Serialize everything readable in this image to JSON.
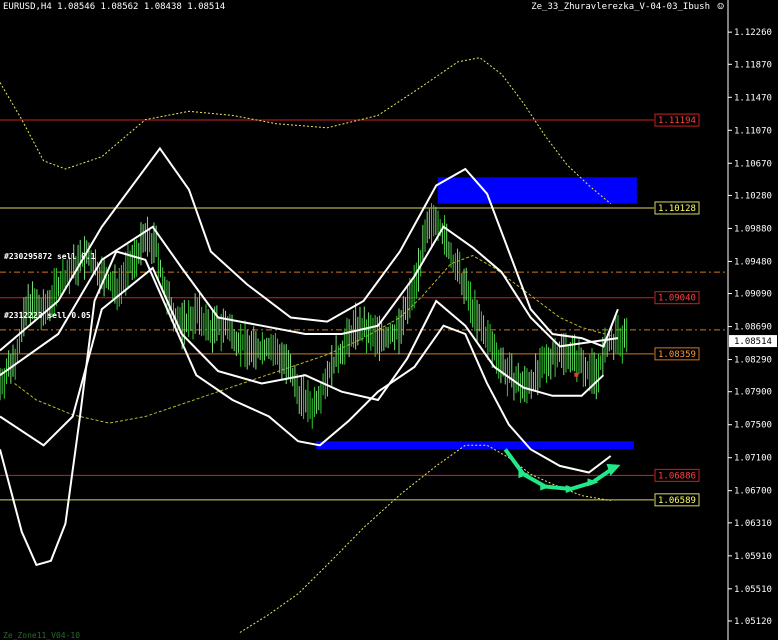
{
  "header": {
    "symbol_ohlc": "EURUSD,H4  1.08546 1.08562 1.08438 1.08514",
    "indicator_name": "Ze_33_Zhuravlerezka_V-04-03_Ibush",
    "smile": "☺"
  },
  "orders": [
    {
      "text": "#230295872 sell 0.1"
    },
    {
      "text": "#2312223 sell 0.05"
    }
  ],
  "footer": "Ze_Zone11_V04-10",
  "chart_data": {
    "type": "candlestick",
    "ylim": [
      1.0495,
      1.1248
    ],
    "yticks": [
      "1.12260",
      "1.11870",
      "1.11470",
      "1.11070",
      "1.10670",
      "1.10280",
      "1.09880",
      "1.09480",
      "1.09090",
      "1.08690",
      "1.08290",
      "1.07900",
      "1.07500",
      "1.07100",
      "1.06700",
      "1.06310",
      "1.05910",
      "1.05510",
      "1.05120"
    ],
    "current_price": "1.08514",
    "levels": [
      {
        "label": "1.11194",
        "value": 1.11194,
        "color": "#cc2222",
        "text": "#ff4040",
        "style": "solid"
      },
      {
        "label": "1.10128",
        "value": 1.10128,
        "color": "#d8d860",
        "text": "#ffff66",
        "style": "solid"
      },
      {
        "label": "1.09040",
        "value": 1.0904,
        "color": "#cc2222",
        "text": "#ff4040",
        "style": "solid"
      },
      {
        "label": "1.08359",
        "value": 1.08359,
        "color": "#d07820",
        "text": "#ff9a30",
        "style": "solid"
      },
      {
        "label": "1.06886",
        "value": 1.06886,
        "color": "#cc2222",
        "text": "#ff4040",
        "style": "solid"
      },
      {
        "label": "1.06589",
        "value": 1.06589,
        "color": "#d8d860",
        "text": "#ffff66",
        "style": "solid"
      }
    ],
    "order_lines": [
      1.0935,
      1.0865
    ],
    "zones": [
      {
        "color": "#0000ff",
        "price_top": 1.105,
        "price_bottom": 1.1018,
        "bar_start": 0.602,
        "bar_end": 0.876
      },
      {
        "color": "#0000ff",
        "price_top": 1.073,
        "price_bottom": 1.0722,
        "bar_start": 0.435,
        "bar_end": 0.872
      }
    ],
    "price_path": [
      [
        0,
        1.08
      ],
      [
        0.02,
        1.083
      ],
      [
        0.04,
        1.09
      ],
      [
        0.06,
        1.0885
      ],
      [
        0.08,
        1.092
      ],
      [
        0.1,
        1.094
      ],
      [
        0.12,
        1.0955
      ],
      [
        0.14,
        1.093
      ],
      [
        0.16,
        1.0915
      ],
      [
        0.18,
        1.0945
      ],
      [
        0.2,
        1.0975
      ],
      [
        0.215,
        1.0965
      ],
      [
        0.23,
        1.09
      ],
      [
        0.25,
        1.087
      ],
      [
        0.27,
        1.0885
      ],
      [
        0.29,
        1.0865
      ],
      [
        0.31,
        1.087
      ],
      [
        0.33,
        1.085
      ],
      [
        0.35,
        1.084
      ],
      [
        0.37,
        1.0845
      ],
      [
        0.39,
        1.083
      ],
      [
        0.41,
        1.079
      ],
      [
        0.43,
        1.077
      ],
      [
        0.45,
        1.081
      ],
      [
        0.47,
        1.084
      ],
      [
        0.49,
        1.087
      ],
      [
        0.51,
        1.086
      ],
      [
        0.53,
        1.0855
      ],
      [
        0.55,
        1.0865
      ],
      [
        0.57,
        1.092
      ],
      [
        0.585,
        1.0975
      ],
      [
        0.6,
        1.1005
      ],
      [
        0.62,
        1.0955
      ],
      [
        0.64,
        1.0915
      ],
      [
        0.66,
        1.087
      ],
      [
        0.68,
        1.084
      ],
      [
        0.7,
        1.081
      ],
      [
        0.72,
        1.0795
      ],
      [
        0.74,
        1.081
      ],
      [
        0.76,
        1.0835
      ],
      [
        0.78,
        1.084
      ],
      [
        0.8,
        1.0825
      ],
      [
        0.82,
        1.081
      ],
      [
        0.835,
        1.0845
      ],
      [
        0.85,
        1.0855
      ],
      [
        0.865,
        1.085
      ]
    ],
    "upper_band_outer": [
      [
        0,
        1.084
      ],
      [
        0.08,
        1.09
      ],
      [
        0.14,
        1.099
      ],
      [
        0.22,
        1.1085
      ],
      [
        0.26,
        1.1035
      ],
      [
        0.29,
        1.096
      ],
      [
        0.34,
        1.092
      ],
      [
        0.4,
        1.088
      ],
      [
        0.45,
        1.0875
      ],
      [
        0.5,
        1.09
      ],
      [
        0.55,
        1.096
      ],
      [
        0.6,
        1.104
      ],
      [
        0.64,
        1.106
      ],
      [
        0.67,
        1.103
      ],
      [
        0.7,
        1.096
      ],
      [
        0.73,
        1.089
      ],
      [
        0.76,
        1.086
      ],
      [
        0.8,
        1.0855
      ],
      [
        0.83,
        1.0845
      ],
      [
        0.85,
        1.089
      ]
    ],
    "upper_band_inner": [
      [
        0,
        1.081
      ],
      [
        0.08,
        1.086
      ],
      [
        0.14,
        1.095
      ],
      [
        0.21,
        1.099
      ],
      [
        0.25,
        1.094
      ],
      [
        0.3,
        1.088
      ],
      [
        0.36,
        1.087
      ],
      [
        0.42,
        1.086
      ],
      [
        0.47,
        1.086
      ],
      [
        0.52,
        1.087
      ],
      [
        0.57,
        1.093
      ],
      [
        0.61,
        1.099
      ],
      [
        0.65,
        1.0965
      ],
      [
        0.69,
        1.0935
      ],
      [
        0.73,
        1.088
      ],
      [
        0.77,
        1.0845
      ],
      [
        0.81,
        1.085
      ],
      [
        0.85,
        1.0855
      ]
    ],
    "lower_band_inner": [
      [
        0,
        1.076
      ],
      [
        0.06,
        1.0725
      ],
      [
        0.1,
        1.076
      ],
      [
        0.14,
        1.089
      ],
      [
        0.21,
        1.094
      ],
      [
        0.25,
        1.086
      ],
      [
        0.3,
        1.0815
      ],
      [
        0.36,
        1.08
      ],
      [
        0.42,
        1.081
      ],
      [
        0.47,
        1.079
      ],
      [
        0.52,
        1.078
      ],
      [
        0.56,
        1.083
      ],
      [
        0.6,
        1.09
      ],
      [
        0.64,
        1.087
      ],
      [
        0.68,
        1.082
      ],
      [
        0.72,
        1.0795
      ],
      [
        0.76,
        1.0785
      ],
      [
        0.8,
        1.0785
      ],
      [
        0.83,
        1.081
      ]
    ],
    "lower_band_outer": [
      [
        0,
        1.072
      ],
      [
        0.03,
        1.062
      ],
      [
        0.05,
        1.058
      ],
      [
        0.07,
        1.0585
      ],
      [
        0.09,
        1.063
      ],
      [
        0.11,
        1.076
      ],
      [
        0.13,
        1.09
      ],
      [
        0.16,
        1.096
      ],
      [
        0.2,
        1.095
      ],
      [
        0.23,
        1.089
      ],
      [
        0.27,
        1.081
      ],
      [
        0.32,
        1.078
      ],
      [
        0.37,
        1.076
      ],
      [
        0.41,
        1.073
      ],
      [
        0.44,
        1.0725
      ],
      [
        0.48,
        1.0755
      ],
      [
        0.52,
        1.079
      ],
      [
        0.57,
        1.082
      ],
      [
        0.61,
        1.087
      ],
      [
        0.64,
        1.086
      ],
      [
        0.67,
        1.08
      ],
      [
        0.7,
        1.075
      ],
      [
        0.73,
        1.072
      ],
      [
        0.77,
        1.07
      ],
      [
        0.81,
        1.0692
      ],
      [
        0.84,
        1.0712
      ]
    ],
    "envelope_upper": [
      [
        0,
        1.1165
      ],
      [
        0.03,
        1.112
      ],
      [
        0.06,
        1.107
      ],
      [
        0.09,
        1.106
      ],
      [
        0.14,
        1.1075
      ],
      [
        0.2,
        1.112
      ],
      [
        0.26,
        1.113
      ],
      [
        0.32,
        1.1125
      ],
      [
        0.38,
        1.1115
      ],
      [
        0.45,
        1.111
      ],
      [
        0.52,
        1.1125
      ],
      [
        0.58,
        1.116
      ],
      [
        0.63,
        1.119
      ],
      [
        0.66,
        1.1195
      ],
      [
        0.69,
        1.1175
      ],
      [
        0.72,
        1.114
      ],
      [
        0.75,
        1.11
      ],
      [
        0.78,
        1.1065
      ],
      [
        0.81,
        1.104
      ],
      [
        0.84,
        1.1018
      ]
    ],
    "envelope_lower": [
      [
        0.33,
        1.0498
      ],
      [
        0.37,
        1.052
      ],
      [
        0.41,
        1.0545
      ],
      [
        0.45,
        1.058
      ],
      [
        0.5,
        1.0625
      ],
      [
        0.55,
        1.0665
      ],
      [
        0.6,
        1.07
      ],
      [
        0.64,
        1.0725
      ],
      [
        0.67,
        1.0725
      ],
      [
        0.7,
        1.071
      ],
      [
        0.73,
        1.069
      ],
      [
        0.76,
        1.0678
      ],
      [
        0.8,
        1.0664
      ],
      [
        0.84,
        1.0658
      ]
    ],
    "ma_yellow": [
      [
        0.02,
        1.08
      ],
      [
        0.05,
        1.078
      ],
      [
        0.1,
        1.0762
      ],
      [
        0.15,
        1.0752
      ],
      [
        0.2,
        1.076
      ],
      [
        0.25,
        1.0775
      ],
      [
        0.3,
        1.079
      ],
      [
        0.35,
        1.0805
      ],
      [
        0.4,
        1.082
      ],
      [
        0.45,
        1.0835
      ],
      [
        0.5,
        1.0855
      ],
      [
        0.55,
        1.088
      ],
      [
        0.58,
        1.0905
      ],
      [
        0.62,
        1.0945
      ],
      [
        0.65,
        1.0955
      ],
      [
        0.68,
        1.094
      ],
      [
        0.71,
        1.092
      ],
      [
        0.74,
        1.09
      ],
      [
        0.77,
        1.088
      ],
      [
        0.8,
        1.0868
      ],
      [
        0.84,
        1.0858
      ]
    ],
    "arrow_points": [
      [
        0.695,
        1.072
      ],
      [
        0.72,
        1.069
      ],
      [
        0.75,
        1.0675
      ],
      [
        0.785,
        1.0672
      ],
      [
        0.815,
        1.068
      ],
      [
        0.848,
        1.07
      ]
    ]
  }
}
